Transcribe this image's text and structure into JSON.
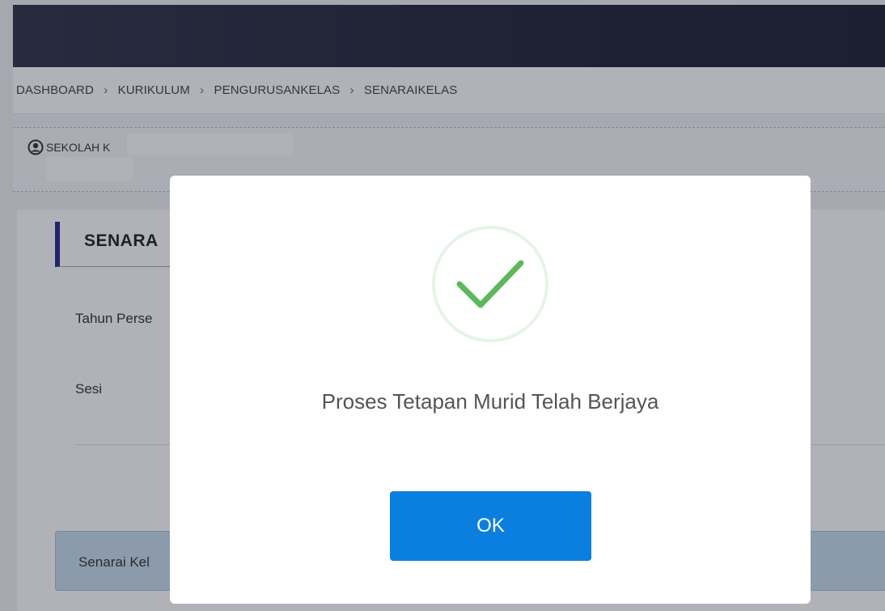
{
  "breadcrumb": {
    "items": [
      "DASHBOARD",
      "KURIKULUM",
      "PENGURUSANKELAS",
      "SENARAIKELAS"
    ],
    "separator": "›"
  },
  "school": {
    "label": "SEKOLAH K",
    "icon": "user-circle-icon"
  },
  "section": {
    "title": "SENARA"
  },
  "form": {
    "year_label": "Tahun Perse",
    "session_label": "Sesi"
  },
  "list_bar": {
    "label": "Senarai Kel"
  },
  "modal": {
    "icon": "success-check-icon",
    "message": "Proses Tetapan Murid Telah Berjaya",
    "ok_label": "OK"
  },
  "colors": {
    "topbar": "#23253a",
    "section_accent": "#232b8c",
    "ok_button": "#0b7fe0",
    "success_check": "#5cb85c",
    "success_ring": "#e6f4e6"
  }
}
